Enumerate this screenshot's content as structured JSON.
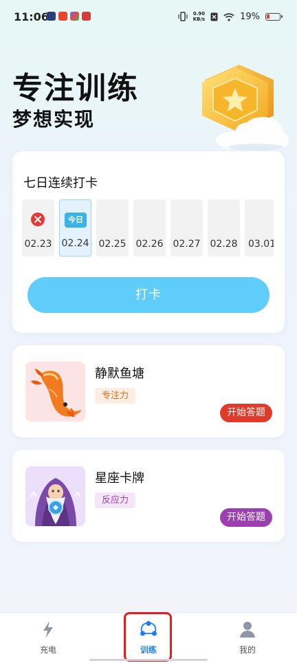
{
  "status_bar": {
    "time": "11:06",
    "net_speed_top": "0.90",
    "net_speed_bottom": "KB/s",
    "battery": "19%"
  },
  "hero": {
    "title": "专注训练",
    "subtitle": "梦想实现"
  },
  "checkin": {
    "title": "七日连续打卡",
    "today_label": "今日",
    "days": [
      {
        "date": "02.23",
        "state": "missed"
      },
      {
        "date": "02.24",
        "state": "today"
      },
      {
        "date": "02.25",
        "state": "future"
      },
      {
        "date": "02.26",
        "state": "future"
      },
      {
        "date": "02.27",
        "state": "future"
      },
      {
        "date": "02.28",
        "state": "future"
      },
      {
        "date": "03.01",
        "state": "future"
      }
    ],
    "button_label": "打卡"
  },
  "games": [
    {
      "name": "静默鱼塘",
      "tag": "专注力",
      "button": "开始答题",
      "icon": "koi-fish-illustration",
      "accent": "#e03a2a"
    },
    {
      "name": "星座卡牌",
      "tag": "反应力",
      "button": "开始答题",
      "icon": "wizard-illustration",
      "accent": "#9b3fb1"
    }
  ],
  "tabbar": {
    "items": [
      {
        "label": "充电",
        "icon": "lightning-icon"
      },
      {
        "label": "训练",
        "icon": "network-icon",
        "active": true
      },
      {
        "label": "我的",
        "icon": "person-icon"
      }
    ],
    "active_color": "#1f7fe8"
  }
}
